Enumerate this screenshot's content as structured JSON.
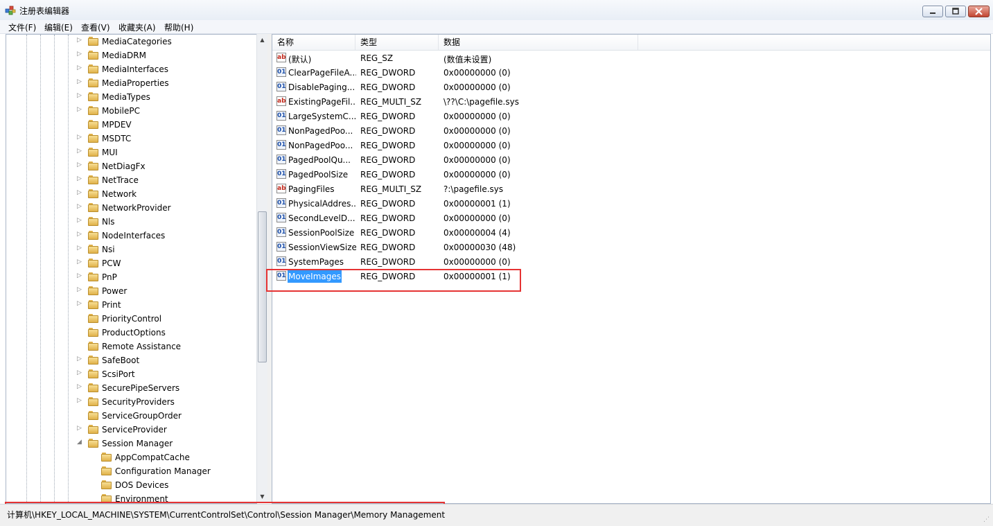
{
  "window": {
    "title": "注册表编辑器"
  },
  "menu": [
    "文件(F)",
    "编辑(E)",
    "查看(V)",
    "收藏夹(A)",
    "帮助(H)"
  ],
  "tree": {
    "items": [
      {
        "label": "MediaCategories",
        "level": 0,
        "state": "collapsed"
      },
      {
        "label": "MediaDRM",
        "level": 0,
        "state": "collapsed"
      },
      {
        "label": "MediaInterfaces",
        "level": 0,
        "state": "collapsed"
      },
      {
        "label": "MediaProperties",
        "level": 0,
        "state": "collapsed"
      },
      {
        "label": "MediaTypes",
        "level": 0,
        "state": "collapsed"
      },
      {
        "label": "MobilePC",
        "level": 0,
        "state": "collapsed"
      },
      {
        "label": "MPDEV",
        "level": 0,
        "state": "leaf"
      },
      {
        "label": "MSDTC",
        "level": 0,
        "state": "collapsed"
      },
      {
        "label": "MUI",
        "level": 0,
        "state": "collapsed"
      },
      {
        "label": "NetDiagFx",
        "level": 0,
        "state": "collapsed"
      },
      {
        "label": "NetTrace",
        "level": 0,
        "state": "collapsed"
      },
      {
        "label": "Network",
        "level": 0,
        "state": "collapsed"
      },
      {
        "label": "NetworkProvider",
        "level": 0,
        "state": "collapsed"
      },
      {
        "label": "Nls",
        "level": 0,
        "state": "collapsed"
      },
      {
        "label": "NodeInterfaces",
        "level": 0,
        "state": "collapsed"
      },
      {
        "label": "Nsi",
        "level": 0,
        "state": "collapsed"
      },
      {
        "label": "PCW",
        "level": 0,
        "state": "collapsed"
      },
      {
        "label": "PnP",
        "level": 0,
        "state": "collapsed"
      },
      {
        "label": "Power",
        "level": 0,
        "state": "collapsed"
      },
      {
        "label": "Print",
        "level": 0,
        "state": "collapsed"
      },
      {
        "label": "PriorityControl",
        "level": 0,
        "state": "leaf"
      },
      {
        "label": "ProductOptions",
        "level": 0,
        "state": "leaf"
      },
      {
        "label": "Remote Assistance",
        "level": 0,
        "state": "leaf"
      },
      {
        "label": "SafeBoot",
        "level": 0,
        "state": "collapsed"
      },
      {
        "label": "ScsiPort",
        "level": 0,
        "state": "collapsed"
      },
      {
        "label": "SecurePipeServers",
        "level": 0,
        "state": "collapsed"
      },
      {
        "label": "SecurityProviders",
        "level": 0,
        "state": "collapsed"
      },
      {
        "label": "ServiceGroupOrder",
        "level": 0,
        "state": "leaf"
      },
      {
        "label": "ServiceProvider",
        "level": 0,
        "state": "collapsed"
      },
      {
        "label": "Session Manager",
        "level": 0,
        "state": "expanded"
      },
      {
        "label": "AppCompatCache",
        "level": 1,
        "state": "leaf"
      },
      {
        "label": "Configuration Manager",
        "level": 1,
        "state": "leaf"
      },
      {
        "label": "DOS Devices",
        "level": 1,
        "state": "leaf"
      },
      {
        "label": "Environment",
        "level": 1,
        "state": "leaf"
      }
    ]
  },
  "list": {
    "columns": [
      "名称",
      "类型",
      "数据"
    ],
    "rows": [
      {
        "icon": "sz",
        "name": "(默认)",
        "type": "REG_SZ",
        "data": "(数值未设置)"
      },
      {
        "icon": "bin",
        "name": "ClearPageFileA...",
        "type": "REG_DWORD",
        "data": "0x00000000 (0)"
      },
      {
        "icon": "bin",
        "name": "DisablePaging...",
        "type": "REG_DWORD",
        "data": "0x00000000 (0)"
      },
      {
        "icon": "sz",
        "name": "ExistingPageFil...",
        "type": "REG_MULTI_SZ",
        "data": "\\??\\C:\\pagefile.sys"
      },
      {
        "icon": "bin",
        "name": "LargeSystemC...",
        "type": "REG_DWORD",
        "data": "0x00000000 (0)"
      },
      {
        "icon": "bin",
        "name": "NonPagedPoo...",
        "type": "REG_DWORD",
        "data": "0x00000000 (0)"
      },
      {
        "icon": "bin",
        "name": "NonPagedPoo...",
        "type": "REG_DWORD",
        "data": "0x00000000 (0)"
      },
      {
        "icon": "bin",
        "name": "PagedPoolQu...",
        "type": "REG_DWORD",
        "data": "0x00000000 (0)"
      },
      {
        "icon": "bin",
        "name": "PagedPoolSize",
        "type": "REG_DWORD",
        "data": "0x00000000 (0)"
      },
      {
        "icon": "sz",
        "name": "PagingFiles",
        "type": "REG_MULTI_SZ",
        "data": "?:\\pagefile.sys"
      },
      {
        "icon": "bin",
        "name": "PhysicalAddres...",
        "type": "REG_DWORD",
        "data": "0x00000001 (1)"
      },
      {
        "icon": "bin",
        "name": "SecondLevelD...",
        "type": "REG_DWORD",
        "data": "0x00000000 (0)"
      },
      {
        "icon": "bin",
        "name": "SessionPoolSize",
        "type": "REG_DWORD",
        "data": "0x00000004 (4)"
      },
      {
        "icon": "bin",
        "name": "SessionViewSize",
        "type": "REG_DWORD",
        "data": "0x00000030 (48)"
      },
      {
        "icon": "bin",
        "name": "SystemPages",
        "type": "REG_DWORD",
        "data": "0x00000000 (0)"
      },
      {
        "icon": "bin",
        "name": "MoveImages",
        "type": "REG_DWORD",
        "data": "0x00000001 (1)",
        "selected": true
      }
    ]
  },
  "status": {
    "path": "计算机\\HKEY_LOCAL_MACHINE\\SYSTEM\\CurrentControlSet\\Control\\Session Manager\\Memory Management"
  },
  "icons": {
    "sz": "ab",
    "bin": "011"
  },
  "colors": {
    "highlight": "#e53333",
    "selection": "#3399ff"
  }
}
